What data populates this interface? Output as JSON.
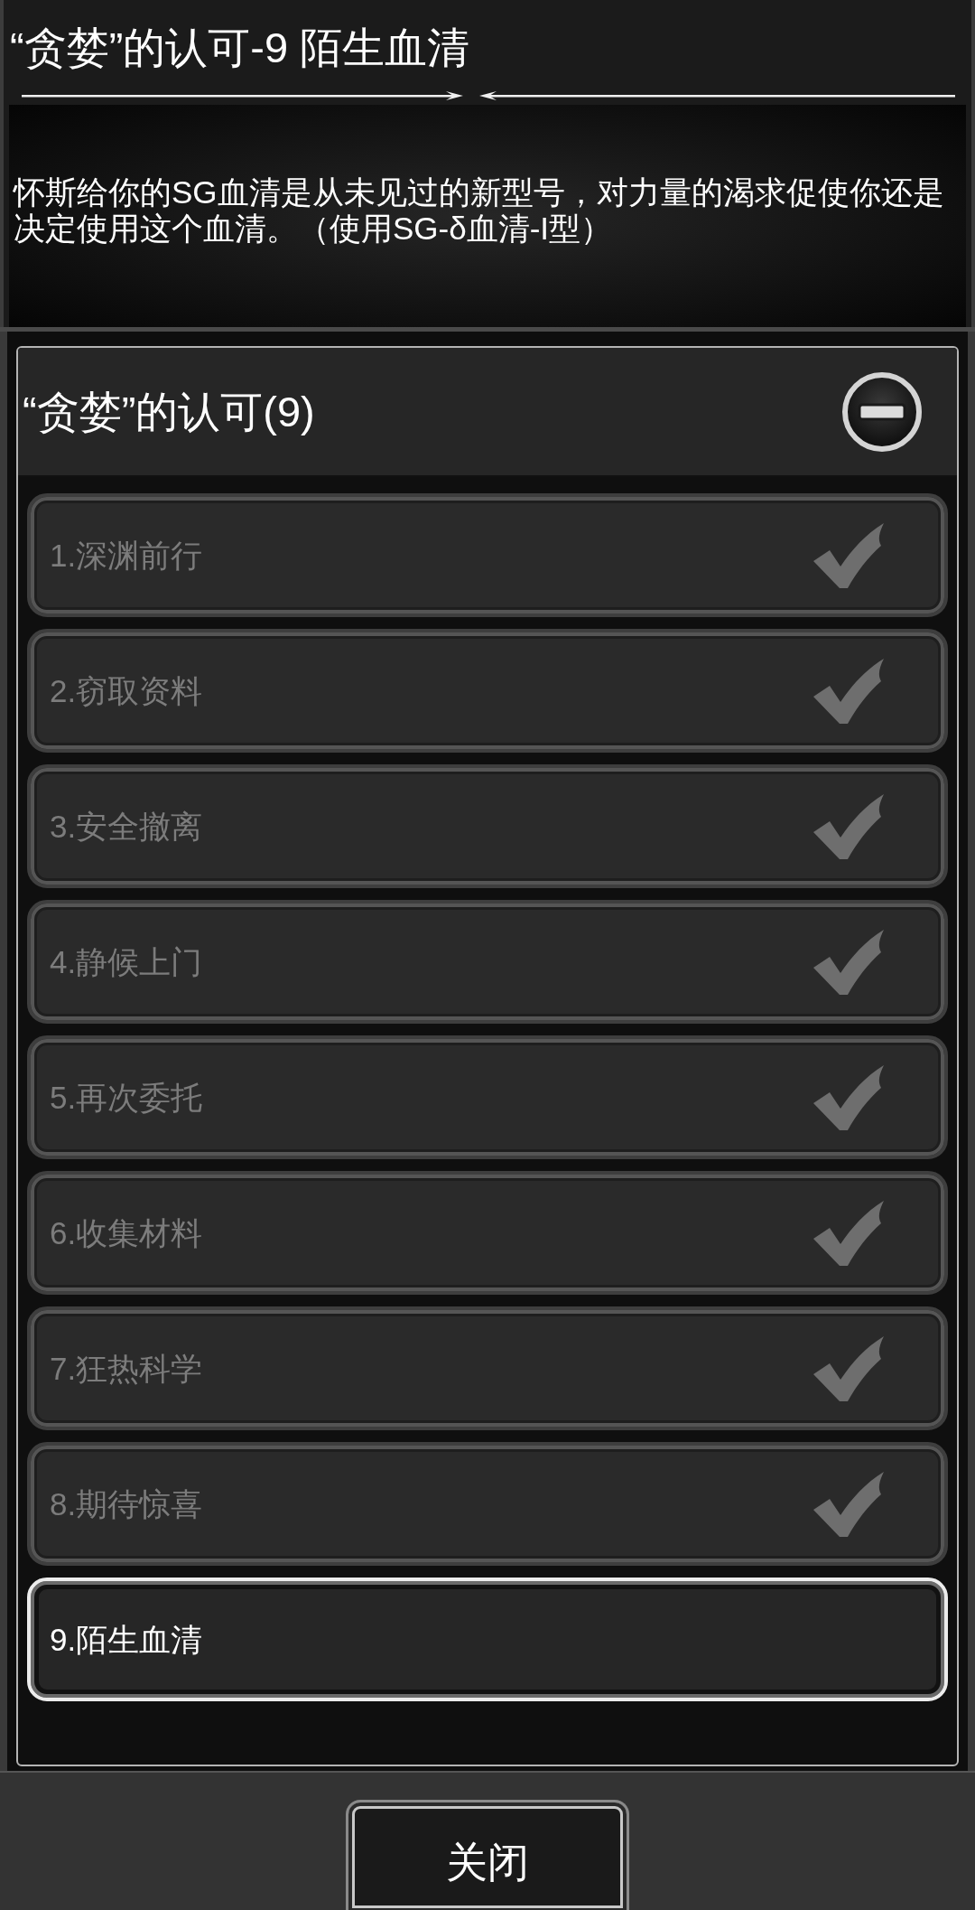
{
  "dialog_title": "“贪婪”的认可-9 陌生血清",
  "description": "怀斯给你的SG血清是从未见过的新型号，对力量的渴求促使你还是决定使用这个血清。（使用SG-δ血清-I型）",
  "quest_group": {
    "title": "“贪婪”的认可(9)",
    "expanded": true,
    "steps": [
      {
        "label": "1.深渊前行",
        "completed": true,
        "selected": false
      },
      {
        "label": "2.窃取资料",
        "completed": true,
        "selected": false
      },
      {
        "label": "3.安全撤离",
        "completed": true,
        "selected": false
      },
      {
        "label": "4.静候上门",
        "completed": true,
        "selected": false
      },
      {
        "label": "5.再次委托",
        "completed": true,
        "selected": false
      },
      {
        "label": "6.收集材料",
        "completed": true,
        "selected": false
      },
      {
        "label": "7.狂热科学",
        "completed": true,
        "selected": false
      },
      {
        "label": "8.期待惊喜",
        "completed": true,
        "selected": false
      },
      {
        "label": "9.陌生血清",
        "completed": false,
        "selected": true
      }
    ]
  },
  "buttons": [
    {
      "label": "关闭"
    }
  ]
}
